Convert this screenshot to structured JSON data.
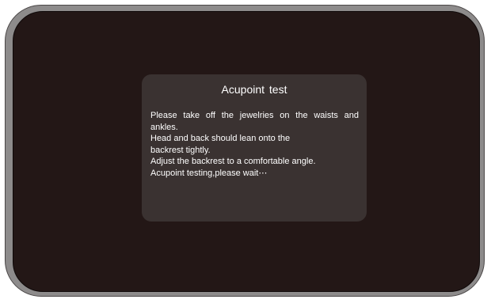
{
  "dialog": {
    "title": "Acupoint  test",
    "lines": [
      "Please take off the jewelries on the waists and ankles.",
      "Head and back should lean onto the backrest tightly.",
      "Adjust the backrest to a comfortable angle.",
      "Acupoint testing,please wait⋯"
    ]
  },
  "colors": {
    "frame": "#8d8b8b",
    "screen": "#231716",
    "dialog": "#3a3231",
    "text": "#ffffff"
  }
}
